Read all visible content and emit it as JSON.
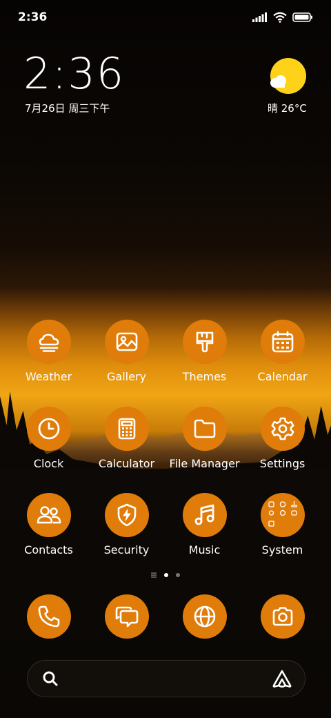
{
  "status_bar": {
    "time": "2:36",
    "icons": [
      "signal-icon",
      "wifi-icon",
      "battery-icon"
    ]
  },
  "clock_widget": {
    "time": "2:36",
    "date": "7月26日 周三下午"
  },
  "weather_widget": {
    "condition_temp": "晴 26°C",
    "icon": "sunny-cloud-icon"
  },
  "apps": [
    {
      "label": "Weather",
      "icon": "weather-icon"
    },
    {
      "label": "Gallery",
      "icon": "gallery-icon"
    },
    {
      "label": "Themes",
      "icon": "brush-icon"
    },
    {
      "label": "Calendar",
      "icon": "calendar-icon"
    },
    {
      "label": "Clock",
      "icon": "clock-icon"
    },
    {
      "label": "Calculator",
      "icon": "calculator-icon"
    },
    {
      "label": "File Manager",
      "icon": "folder-icon"
    },
    {
      "label": "Settings",
      "icon": "gear-icon"
    },
    {
      "label": "Contacts",
      "icon": "contacts-icon"
    },
    {
      "label": "Security",
      "icon": "shield-icon"
    },
    {
      "label": "Music",
      "icon": "music-icon"
    },
    {
      "label": "System",
      "icon": "folder-grid-icon"
    }
  ],
  "dock": [
    {
      "icon": "phone-icon"
    },
    {
      "icon": "messages-icon"
    },
    {
      "icon": "browser-icon"
    },
    {
      "icon": "camera-icon"
    }
  ],
  "colors": {
    "icon_bg": "#e07c0a",
    "sun": "#ffd21a"
  }
}
